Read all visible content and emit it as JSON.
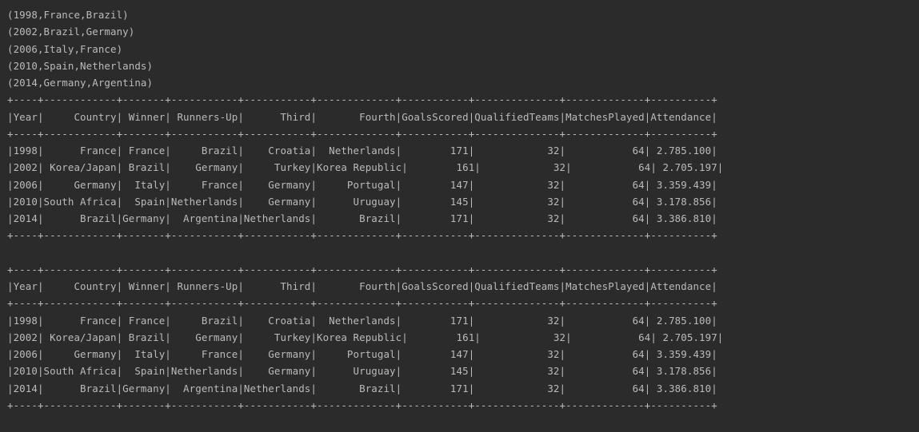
{
  "console": {
    "tuples": [
      "(1998,France,Brazil)",
      "(2002,Brazil,Germany)",
      "(2006,Italy,France)",
      "(2010,Spain,Netherlands)",
      "(2014,Germany,Argentina)"
    ],
    "tables": [
      {
        "border": "+----+------------+-------+-----------+-----------+-------------+-----------+--------------+-------------+----------+",
        "header": "|Year|     Country| Winner| Runners-Up|      Third|       Fourth|GoalsScored|QualifiedTeams|MatchesPlayed|Attendance|",
        "rows": [
          "|1998|      France| France|     Brazil|    Croatia|  Netherlands|        171|            32|           64| 2.785.100|",
          "|2002| Korea/Japan| Brazil|    Germany|     Turkey|Korea Republic|        161|            32|           64| 2.705.197|",
          "|2006|     Germany|  Italy|     France|    Germany|     Portugal|        147|            32|           64| 3.359.439|",
          "|2010|South Africa|  Spain|Netherlands|    Germany|      Uruguay|        145|            32|           64| 3.178.856|",
          "|2014|      Brazil|Germany|  Argentina|Netherlands|       Brazil|        171|            32|           64| 3.386.810|"
        ]
      },
      {
        "border": "+----+------------+-------+-----------+-----------+-------------+-----------+--------------+-------------+----------+",
        "header": "|Year|     Country| Winner| Runners-Up|      Third|       Fourth|GoalsScored|QualifiedTeams|MatchesPlayed|Attendance|",
        "rows": [
          "|1998|      France| France|     Brazil|    Croatia|  Netherlands|        171|            32|           64| 2.785.100|",
          "|2002| Korea/Japan| Brazil|    Germany|     Turkey|Korea Republic|        161|            32|           64| 2.705.197|",
          "|2006|     Germany|  Italy|     France|    Germany|     Portugal|        147|            32|           64| 3.359.439|",
          "|2010|South Africa|  Spain|Netherlands|    Germany|      Uruguay|        145|            32|           64| 3.178.856|",
          "|2014|      Brazil|Germany|  Argentina|Netherlands|       Brazil|        171|            32|           64| 3.386.810|"
        ]
      }
    ]
  }
}
